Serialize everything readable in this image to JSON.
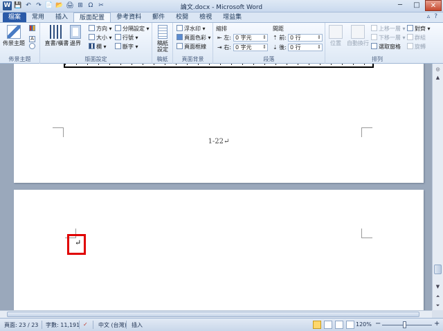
{
  "window": {
    "app_letter": "W",
    "title": "論文.docx - Microsoft Word",
    "buttons": {
      "minimize": "─",
      "maximize": "□",
      "close": "✕"
    }
  },
  "quick_access": [
    "💾",
    "↶",
    "↷",
    "📄",
    "📂",
    "🖨",
    "⊞",
    "Ω",
    "✂"
  ],
  "tabs": [
    {
      "label": "檔案",
      "kind": "file"
    },
    {
      "label": "常用",
      "kind": "normal"
    },
    {
      "label": "插入",
      "kind": "normal"
    },
    {
      "label": "版面配置",
      "kind": "active"
    },
    {
      "label": "參考資料",
      "kind": "normal"
    },
    {
      "label": "郵件",
      "kind": "normal"
    },
    {
      "label": "校閱",
      "kind": "normal"
    },
    {
      "label": "檢視",
      "kind": "normal"
    },
    {
      "label": "增益集",
      "kind": "normal"
    }
  ],
  "ribbon": {
    "theme_group": {
      "label": "佈景主題",
      "big_button": "佈景主題"
    },
    "page_setup": {
      "label": "版面設定",
      "orientation_button": "直書/橫書",
      "margins_button": "邊界",
      "direction": "方向",
      "size": "大小",
      "columns": "欄",
      "breaks": "分隔設定",
      "line_numbers": "行號",
      "hyphenation": "斷字"
    },
    "draft_group": {
      "label": "稿紙",
      "button": "稿紙設定"
    },
    "page_background": {
      "label": "頁面背景",
      "watermark": "浮水印",
      "page_color": "頁面色彩",
      "page_borders": "頁面框線"
    },
    "paragraph": {
      "label": "段落",
      "indent_header": "縮排",
      "spacing_header": "間距",
      "left_label": "左:",
      "left_value": "0 字元",
      "right_label": "右:",
      "right_value": "0 字元",
      "before_label": "前:",
      "before_value": "0 行",
      "after_label": "後:",
      "after_value": "0 行"
    },
    "arrange": {
      "label": "排列",
      "position": "位置",
      "wrap_text": "自動換行",
      "bring_forward": "上移一層",
      "send_backward": "下移一層",
      "selection_pane": "選取窗格",
      "align": "對齊",
      "group": "群組",
      "rotate": "旋轉"
    }
  },
  "document": {
    "page_number_text": "1-22↵",
    "cursor_mark": "↵"
  },
  "statusbar": {
    "page": "頁面: 23 / 23",
    "words": "字數: 11,191",
    "language": "中文 (台灣)",
    "mode": "插入",
    "zoom": "120%",
    "zoom_minus": "−",
    "zoom_plus": "+"
  }
}
